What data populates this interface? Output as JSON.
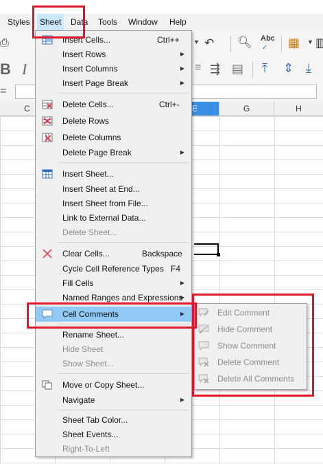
{
  "menubar": {
    "items": [
      "Styles",
      "Sheet",
      "Data",
      "Tools",
      "Window",
      "Help"
    ],
    "active": "Sheet"
  },
  "columns": [
    "C",
    "E",
    "G",
    "H"
  ],
  "sheet_menu": {
    "items": [
      {
        "label": "Insert Cells...",
        "shortcut": "Ctrl++",
        "icon": "insert-cells-icon"
      },
      {
        "label": "Insert Rows",
        "submenu": true
      },
      {
        "label": "Insert Columns",
        "submenu": true
      },
      {
        "label": "Insert Page Break",
        "submenu": true
      },
      {
        "label": "Delete Cells...",
        "shortcut": "Ctrl+-",
        "icon": "delete-cells-icon"
      },
      {
        "label": "Delete Rows",
        "icon": "delete-rows-icon"
      },
      {
        "label": "Delete Columns",
        "icon": "delete-columns-icon"
      },
      {
        "label": "Delete Page Break",
        "submenu": true
      },
      {
        "label": "Insert Sheet...",
        "icon": "insert-sheet-icon"
      },
      {
        "label": "Insert Sheet at End..."
      },
      {
        "label": "Insert Sheet from File..."
      },
      {
        "label": "Link to External Data..."
      },
      {
        "label": "Delete Sheet...",
        "disabled": true
      },
      {
        "label": "Clear Cells...",
        "shortcut": "Backspace",
        "icon": "clear-cells-icon"
      },
      {
        "label": "Cycle Cell Reference Types",
        "shortcut": "F4"
      },
      {
        "label": "Fill Cells",
        "submenu": true
      },
      {
        "label": "Named Ranges and Expressions",
        "submenu": true
      },
      {
        "label": "Cell Comments",
        "submenu": true,
        "highlighted": true,
        "icon": "comment-icon"
      },
      {
        "label": "Rename Sheet..."
      },
      {
        "label": "Hide Sheet",
        "disabled": true
      },
      {
        "label": "Show Sheet...",
        "disabled": true
      },
      {
        "label": "Move or Copy Sheet...",
        "icon": "copy-sheet-icon"
      },
      {
        "label": "Navigate",
        "submenu": true
      },
      {
        "label": "Sheet Tab Color..."
      },
      {
        "label": "Sheet Events..."
      },
      {
        "label": "Right-To-Left",
        "disabled": true
      }
    ]
  },
  "comments_submenu": {
    "items": [
      {
        "label": "Edit Comment",
        "icon": "edit-comment-icon"
      },
      {
        "label": "Hide Comment",
        "icon": "hide-comment-icon"
      },
      {
        "label": "Show Comment",
        "icon": "show-comment-icon"
      },
      {
        "label": "Delete Comment",
        "icon": "delete-comment-icon"
      },
      {
        "label": "Delete All Comments",
        "icon": "delete-all-comments-icon"
      }
    ]
  },
  "colors": {
    "highlight_red": "#e0162b",
    "menu_highlight": "#91c9f7",
    "selected_column": "#3b8ee6"
  }
}
